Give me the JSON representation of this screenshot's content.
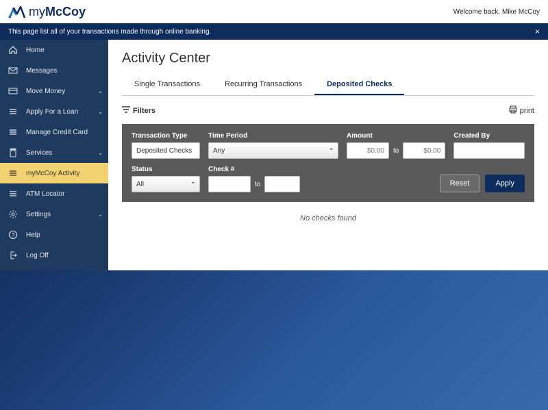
{
  "brand": {
    "prefix": "my",
    "name": "McCoy"
  },
  "welcome": {
    "greeting": "Welcome back,",
    "user": "Mike McCoy"
  },
  "banner": {
    "text": "This page list all of your transactions made through online banking.",
    "close": "×"
  },
  "sidebar": {
    "items": [
      {
        "label": "Home",
        "icon": "home",
        "chev": false
      },
      {
        "label": "Messages",
        "icon": "mail",
        "chev": false
      },
      {
        "label": "Move Money",
        "icon": "card",
        "chev": true
      },
      {
        "label": "Apply For a Loan",
        "icon": "lines",
        "chev": true
      },
      {
        "label": "Manage Credit Card",
        "icon": "lines",
        "chev": false
      },
      {
        "label": "Services",
        "icon": "calc",
        "chev": true
      },
      {
        "label": "myMcCoy Activity",
        "icon": "activity",
        "chev": false,
        "active": true
      },
      {
        "label": "ATM Locator",
        "icon": "lines",
        "chev": false
      },
      {
        "label": "Settings",
        "icon": "gear",
        "chev": true
      },
      {
        "label": "Help",
        "icon": "help",
        "chev": false
      },
      {
        "label": "Log Off",
        "icon": "logout",
        "chev": false
      }
    ]
  },
  "page": {
    "title": "Activity Center"
  },
  "tabs": [
    {
      "label": "Single Transactions",
      "active": false
    },
    {
      "label": "Recurring Transactions",
      "active": false
    },
    {
      "label": "Deposited Checks",
      "active": true
    }
  ],
  "toolbar": {
    "filters": "Filters",
    "print": "print"
  },
  "filters": {
    "labels": {
      "transaction_type": "Transaction Type",
      "time_period": "Time Period",
      "amount": "Amount",
      "created_by": "Created By",
      "status": "Status",
      "check_num": "Check #",
      "to": "to"
    },
    "values": {
      "transaction_type": "Deposited Checks",
      "time_period": "Any",
      "amount_from": "$0.00",
      "amount_to": "$0.00",
      "created_by": "",
      "status": "All",
      "check_from": "",
      "check_to": ""
    },
    "buttons": {
      "reset": "Reset",
      "apply": "Apply"
    }
  },
  "empty_message": "No checks found"
}
